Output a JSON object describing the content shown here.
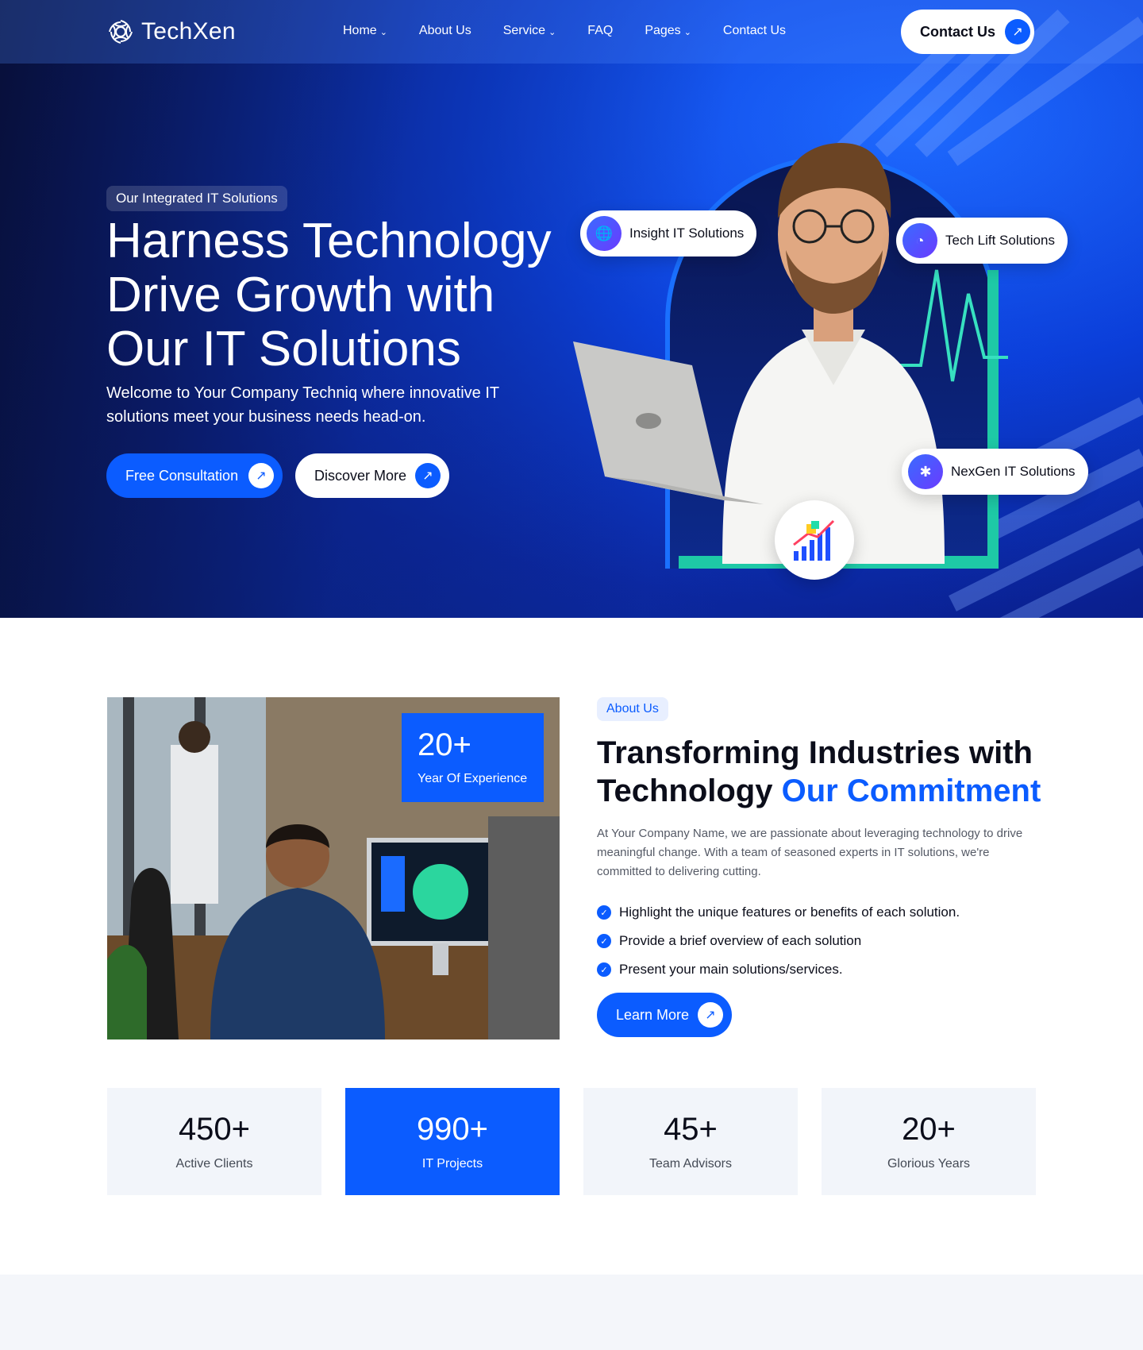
{
  "brand": {
    "name": "TechXen"
  },
  "nav": {
    "items": [
      {
        "label": "Home",
        "dropdown": true
      },
      {
        "label": "About Us",
        "dropdown": false
      },
      {
        "label": "Service",
        "dropdown": true
      },
      {
        "label": "FAQ",
        "dropdown": false
      },
      {
        "label": "Pages",
        "dropdown": true
      },
      {
        "label": "Contact Us",
        "dropdown": false
      }
    ],
    "cta_label": "Contact Us"
  },
  "hero": {
    "badge": "Our Integrated IT Solutions",
    "title": "Harness Technology Drive Growth with Our IT Solutions",
    "subtitle": "Welcome to Your Company Techniq where innovative IT solutions meet your business needs head-on.",
    "primary_button": "Free Consultation",
    "secondary_button": "Discover More",
    "pills": [
      "Insight IT Solutions",
      "Tech Lift Solutions",
      "NexGen IT Solutions"
    ]
  },
  "about": {
    "experience_number": "20+",
    "experience_label": "Year Of Experience",
    "badge": "About Us",
    "title_main": "Transforming Industries with Technology",
    "title_accent": "Our Commitment",
    "description": "At Your Company Name, we are passionate about leveraging technology to drive meaningful change. With a team of seasoned experts in IT solutions, we're committed to delivering cutting.",
    "list": [
      "Highlight the unique features or benefits of each solution.",
      "Provide a brief overview of each solution",
      "Present your main solutions/services."
    ],
    "button": "Learn More"
  },
  "stats": [
    {
      "number": "450+",
      "label": "Active Clients"
    },
    {
      "number": "990+",
      "label": "IT Projects"
    },
    {
      "number": "45+",
      "label": "Team Advisors"
    },
    {
      "number": "20+",
      "label": "Glorious Years"
    }
  ],
  "colors": {
    "primary": "#0b5cff",
    "accent_green": "#1ec9a6",
    "stat_bg": "#f2f5fa"
  },
  "icons": {
    "logo": "swirl-logo-icon",
    "chevron": "chevron-down-icon",
    "arrow": "arrow-up-right-icon",
    "check": "check-circle-icon"
  }
}
